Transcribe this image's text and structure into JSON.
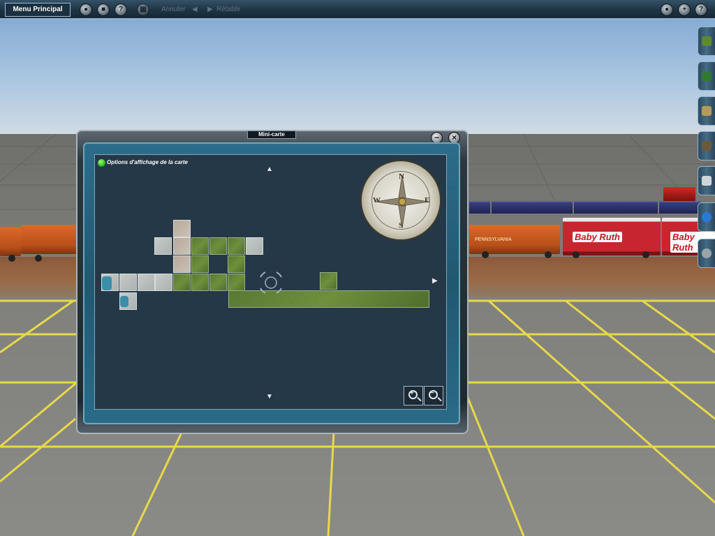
{
  "toolbar": {
    "menu_label": "Menu Principal",
    "undo_label": "Annuler",
    "redo_label": "Rétablir"
  },
  "minimap": {
    "title": "Mini-carte",
    "options_label": "Options d'affichage de la carte",
    "compass": {
      "n": "N",
      "e": "E",
      "s": "S",
      "w": "W"
    }
  },
  "scene": {
    "railcars": [
      "PENNSYLVANIA",
      "Baby Ruth",
      "Baby Ruth"
    ]
  },
  "colors": {
    "toolbar_bg": "#1e3445",
    "window_frame": "#2d6d8b",
    "map_bg": "#243847",
    "grid_lines": "#f2e64a",
    "options_dot": "#1fb21f"
  }
}
